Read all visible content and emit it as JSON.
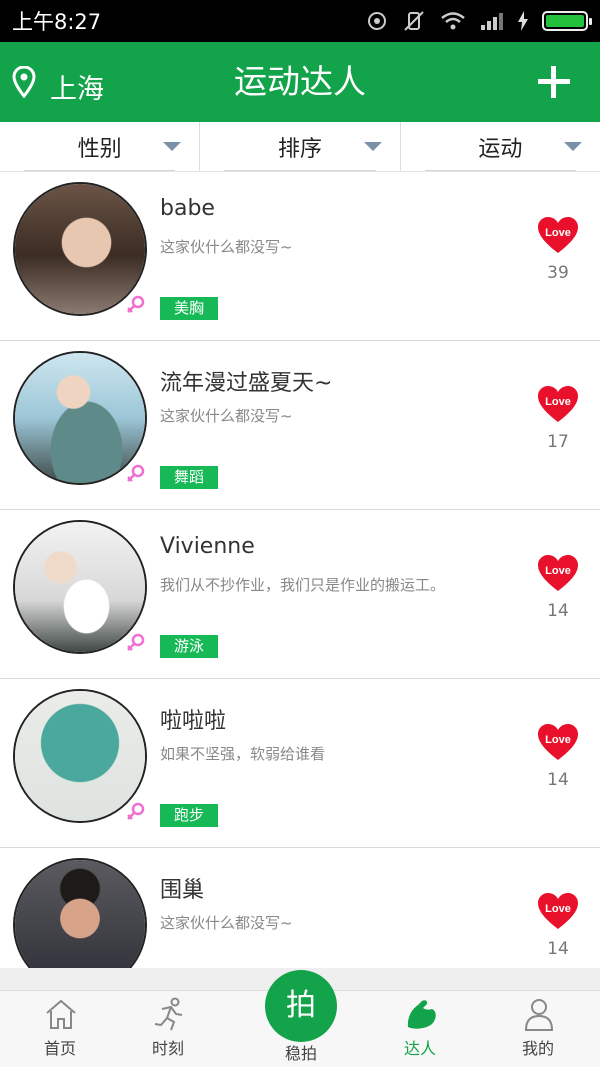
{
  "status_bar": {
    "time": "上午8:27"
  },
  "header": {
    "location": "上海",
    "title": "运动达人"
  },
  "filters": [
    {
      "label": "性别"
    },
    {
      "label": "排序"
    },
    {
      "label": "运动"
    }
  ],
  "users": [
    {
      "name": "babe",
      "bio": "这家伙什么都没写~",
      "tag": "美胸",
      "likes": "39",
      "gender": "female"
    },
    {
      "name": "流年漫过盛夏天~",
      "bio": "这家伙什么都没写~",
      "tag": "舞蹈",
      "likes": "17",
      "gender": "female"
    },
    {
      "name": "Vivienne",
      "bio": "我们从不抄作业，我们只是作业的搬运工。",
      "tag": "游泳",
      "likes": "14",
      "gender": "female"
    },
    {
      "name": "啦啦啦",
      "bio": "如果不坚强，软弱给谁看",
      "tag": "跑步",
      "likes": "14",
      "gender": "female"
    },
    {
      "name": "围巢",
      "bio": "这家伙什么都没写~",
      "tag": "",
      "likes": "14",
      "gender": "male"
    }
  ],
  "like_badge": "Love",
  "tabs": [
    {
      "label": "首页",
      "icon": "home-icon"
    },
    {
      "label": "时刻",
      "icon": "runner-icon"
    },
    {
      "label": "稳拍",
      "icon": "camera-shoot-icon"
    },
    {
      "label": "达人",
      "icon": "muscle-icon",
      "active": true
    },
    {
      "label": "我的",
      "icon": "person-icon"
    }
  ],
  "shoot_button": "拍",
  "colors": {
    "brand_green": "#13a34a",
    "tag_green": "#17b957",
    "heart_red": "#e8102a",
    "female_pink": "#f06fd0"
  }
}
